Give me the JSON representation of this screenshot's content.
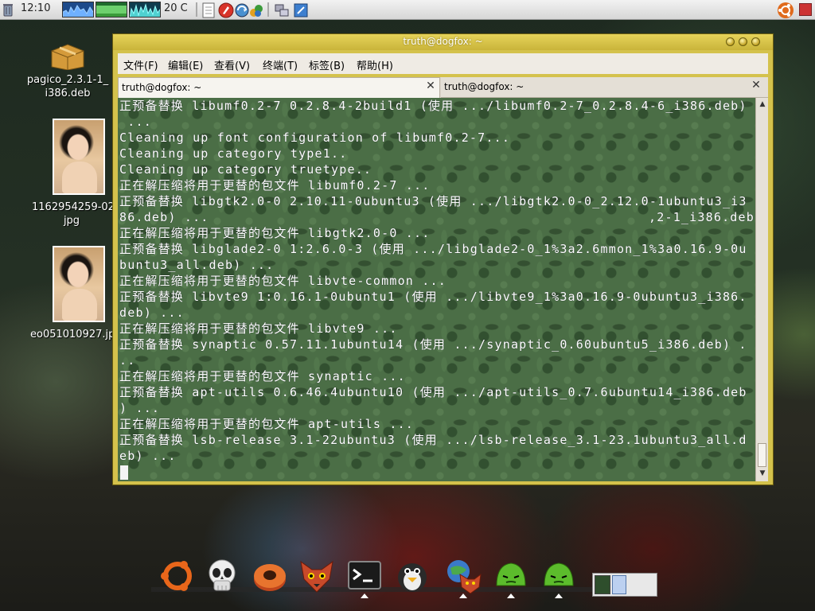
{
  "panel": {
    "clock": "12:10",
    "temperature": "20 C"
  },
  "desktop": {
    "icons": [
      {
        "label": "pagico_2.3.1-1_\ni386.deb"
      },
      {
        "label": "1162954259-02.\njpg"
      },
      {
        "label": "eo051010927.jp"
      }
    ]
  },
  "window": {
    "title": "truth@dogfox: ~",
    "menu": [
      "文件(F)",
      "编辑(E)",
      "查看(V)",
      "终端(T)",
      "标签(B)",
      "帮助(H)"
    ],
    "tabs": [
      {
        "label": "truth@dogfox: ~",
        "active": true
      },
      {
        "label": "truth@dogfox: ~",
        "active": false
      }
    ],
    "terminal_lines": [
      "正预备替换 libumf0.2-7 0.2.8.4-2build1 (使用 .../libumf0.2-7_0.2.8.4-6_i386.deb)",
      " ...",
      "Cleaning up font configuration of libumf0.2-7...",
      "Cleaning up category type1..",
      "Cleaning up category truetype..",
      "正在解压缩将用于更替的包文件 libumf0.2-7 ...",
      "正预备替换 libgtk2.0-0 2.10.11-0ubuntu3 (使用 .../libgtk2.0-0_2.12.0-1ubuntu3_i3",
      "86.deb) ...                                                      ,2-1_i386.deb) ...",
      "正在解压缩将用于更替的包文件 libgtk2.0-0 ...",
      "正预备替换 libglade2-0 1:2.6.0-3 (使用 .../libglade2-0_1%3a2.6mmon_1%3a0.16.9-0u",
      "buntu3_all.deb) ...",
      "正在解压缩将用于更替的包文件 libvte-common ...",
      "正预备替换 libvte9 1:0.16.1-0ubuntu1 (使用 .../libvte9_1%3a0.16.9-0ubuntu3_i386.",
      "deb) ...",
      "正在解压缩将用于更替的包文件 libvte9 ...",
      "正预备替换 synaptic 0.57.11.1ubuntu14 (使用 .../synaptic_0.60ubuntu5_i386.deb) .",
      "..",
      "正在解压缩将用于更替的包文件 synaptic ...",
      "正预备替换 apt-utils 0.6.46.4ubuntu10 (使用 .../apt-utils_0.7.6ubuntu14_i386.deb",
      ") ...",
      "正在解压缩将用于更替的包文件 apt-utils ...",
      "正预备替换 lsb-release 3.1-22ubuntu3 (使用 .../lsb-release_3.1-23.1ubuntu3_all.d",
      "eb) ..."
    ]
  },
  "dock": {
    "items": [
      "ubuntu-logo-icon",
      "skull-icon",
      "ring-icon",
      "fox-icon",
      "terminal-icon",
      "penguin-icon",
      "globe-fox-icon",
      "green-monster-icon",
      "green-monster-icon"
    ]
  },
  "colors": {
    "window_frame": "#d4c24c",
    "terminal_bg": "#4b6e46",
    "terminal_text": "#ffffff"
  }
}
